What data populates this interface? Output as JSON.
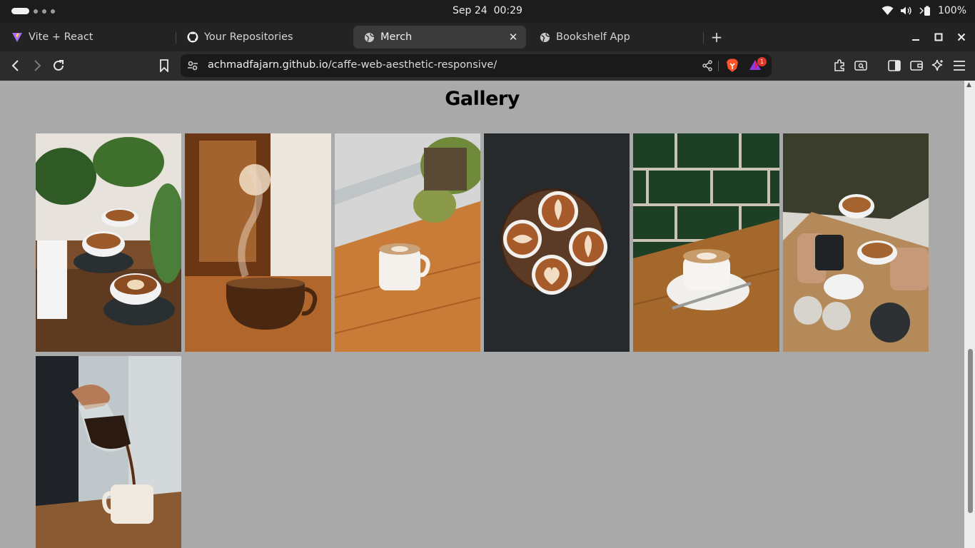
{
  "os": {
    "date": "Sep 24",
    "time": "00:29",
    "battery": "100%"
  },
  "tabs": [
    {
      "label": "Vite + React",
      "icon": "vite-icon"
    },
    {
      "label": "Your Repositories",
      "icon": "github-icon"
    },
    {
      "label": "Merch",
      "icon": "globe-icon",
      "active": true
    },
    {
      "label": "Bookshelf App",
      "icon": "globe-icon"
    }
  ],
  "url": {
    "host": "achmadfajarn.github.io",
    "path": "/caffe-web-aesthetic-responsive/"
  },
  "rewards_badge": "1",
  "page": {
    "title": "Gallery"
  },
  "gallery": [
    {
      "name": "latte-cups-plants"
    },
    {
      "name": "steaming-cup"
    },
    {
      "name": "latte-window-plant"
    },
    {
      "name": "four-lattes-topdown"
    },
    {
      "name": "latte-green-tiles"
    },
    {
      "name": "friends-coffee-table"
    },
    {
      "name": "pour-over-coffee"
    }
  ],
  "colors": {
    "page_bg": "#a9a9a9",
    "tabstrip": "#232323",
    "toolbar": "#2c2c2c",
    "active_tab": "#3b3b3b"
  }
}
